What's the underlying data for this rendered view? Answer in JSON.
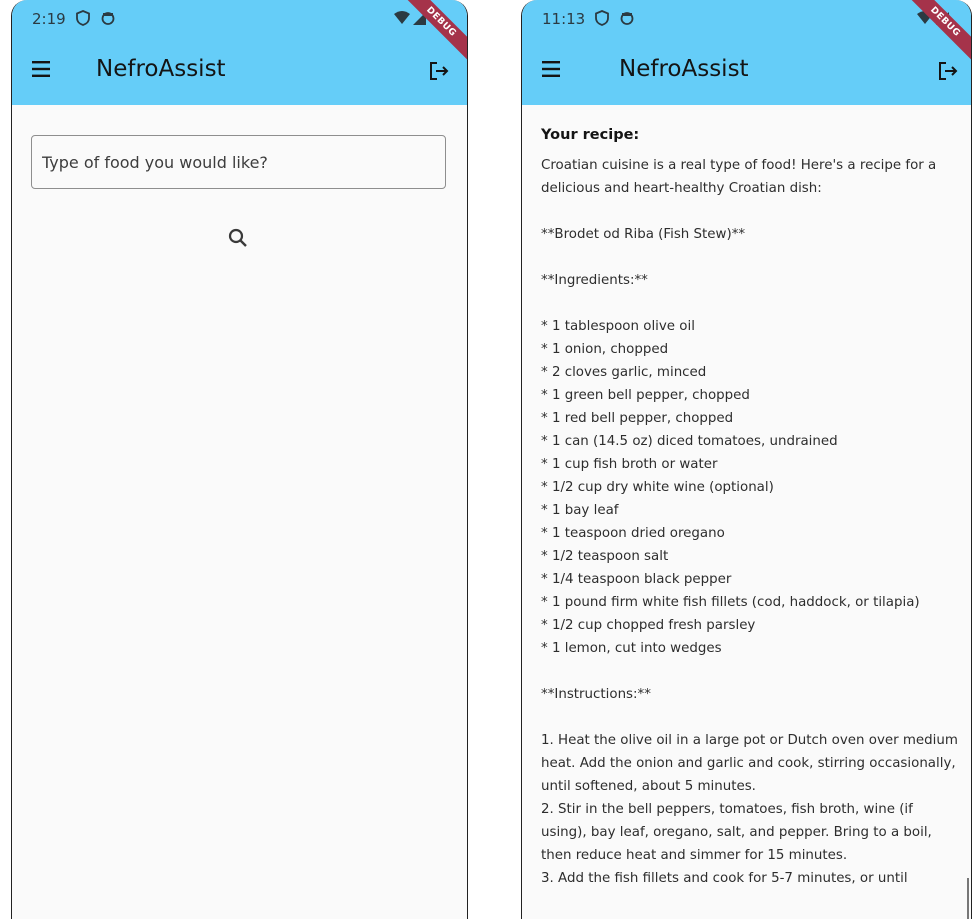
{
  "left_screen": {
    "status_time": "2:19",
    "app_title": "NefroAssist",
    "debug_label": "DEBUG",
    "search_placeholder": "Type of food you would like?"
  },
  "right_screen": {
    "status_time": "11:13",
    "app_title": "NefroAssist",
    "debug_label": "DEBUG",
    "recipe_heading": "Your recipe:",
    "recipe_text": "Croatian cuisine is a real type of food! Here's a recipe for a delicious and heart-healthy Croatian dish:\n\n**Brodet od Riba (Fish Stew)**\n\n**Ingredients:**\n\n* 1 tablespoon olive oil\n* 1 onion, chopped\n* 2 cloves garlic, minced\n* 1 green bell pepper, chopped\n* 1 red bell pepper, chopped\n* 1 can (14.5 oz) diced tomatoes, undrained\n* 1 cup fish broth or water\n* 1/2 cup dry white wine (optional)\n* 1 bay leaf\n* 1 teaspoon dried oregano\n* 1/2 teaspoon salt\n* 1/4 teaspoon black pepper\n* 1 pound firm white fish fillets (cod, haddock, or tilapia)\n* 1/2 cup chopped fresh parsley\n* 1 lemon, cut into wedges\n\n**Instructions:**\n\n1. Heat the olive oil in a large pot or Dutch oven over medium heat. Add the onion and garlic and cook, stirring occasionally, until softened, about 5 minutes.\n2. Stir in the bell peppers, tomatoes, fish broth, wine (if using), bay leaf, oregano, salt, and pepper. Bring to a boil, then reduce heat and simmer for 15 minutes.\n3. Add the fish fillets and cook for 5-7 minutes, or until"
  },
  "icons": {
    "menu": "menu-icon",
    "logout": "logout-icon",
    "search": "search-icon",
    "shield": "shield-icon",
    "sync": "sync-icon",
    "wifi": "wifi-icon",
    "signal": "signal-icon"
  },
  "colors": {
    "app_bar": "#65cdf8",
    "background": "#fafafa",
    "debug_ribbon": "#a5334a"
  }
}
